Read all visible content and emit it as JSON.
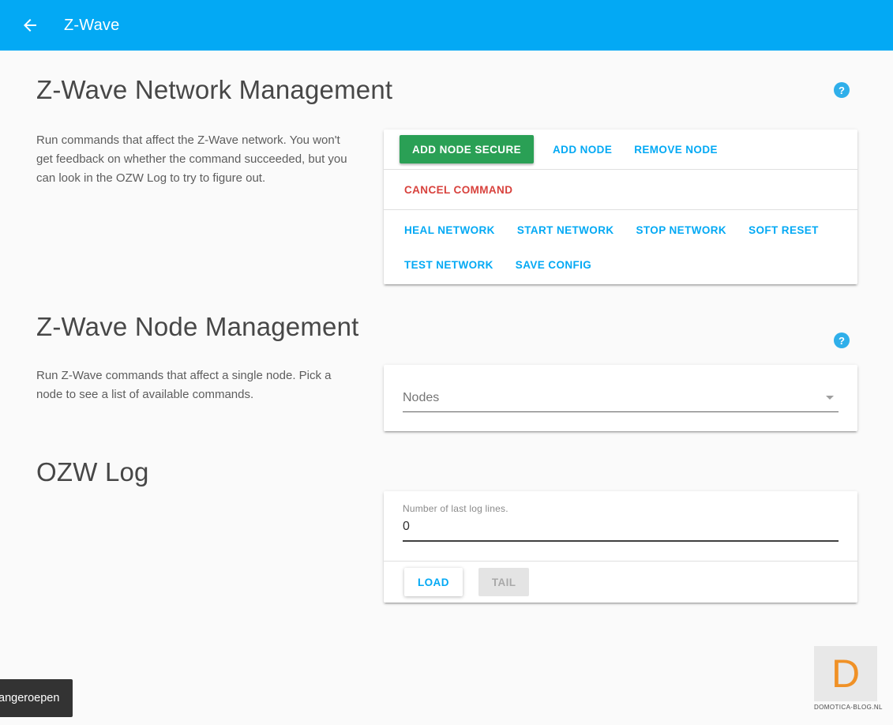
{
  "app_bar": {
    "title": "Z-Wave"
  },
  "icons": {
    "help": "?"
  },
  "colors": {
    "primary": "#03a9f4",
    "accent_green": "#2aa055",
    "danger_red": "#d8423d",
    "appbar_blue": "#03a9f4"
  },
  "network_management": {
    "title": "Z-Wave Network Management",
    "description": "Run commands that affect the Z-Wave network. You won't get feedback on whether the command succeeded, but you can look in the OZW Log to try to figure out.",
    "buttons": {
      "add_node_secure": "ADD NODE SECURE",
      "add_node": "ADD NODE",
      "remove_node": "REMOVE NODE",
      "cancel_command": "CANCEL COMMAND",
      "heal_network": "HEAL NETWORK",
      "start_network": "START NETWORK",
      "stop_network": "STOP NETWORK",
      "soft_reset": "SOFT RESET",
      "test_network": "TEST NETWORK",
      "save_config": "SAVE CONFIG"
    }
  },
  "node_management": {
    "title": "Z-Wave Node Management",
    "description": "Run Z-Wave commands that affect a single node. Pick a node to see a list of available commands.",
    "nodes_select_label": "Nodes"
  },
  "ozw_log": {
    "title": "OZW Log",
    "lines_label": "Number of last log lines.",
    "lines_value": "0",
    "load_button": "LOAD",
    "tail_button": "TAIL"
  },
  "toast": {
    "message": "angeroepen"
  },
  "watermark": {
    "letter": "D",
    "text": "DOMOTICA-BLOG.NL"
  }
}
